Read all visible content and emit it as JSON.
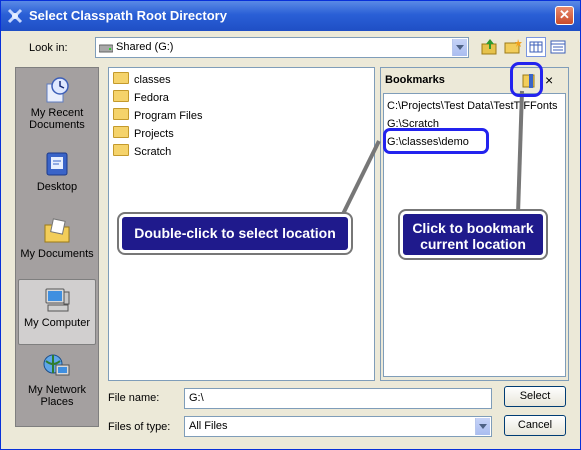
{
  "window": {
    "title": "Select Classpath Root Directory",
    "close_glyph": "✕"
  },
  "lookin": {
    "label": "Look in:",
    "value": "Shared (G:)"
  },
  "places": [
    {
      "label": "My Recent Documents",
      "icon": "recent-documents-icon"
    },
    {
      "label": "Desktop",
      "icon": "desktop-icon"
    },
    {
      "label": "My Documents",
      "icon": "my-documents-icon"
    },
    {
      "label": "My Computer",
      "icon": "my-computer-icon"
    },
    {
      "label": "My Network Places",
      "icon": "network-places-icon"
    }
  ],
  "folders": [
    "classes",
    "Fedora",
    "Program Files",
    "Projects",
    "Scratch"
  ],
  "bookmarks": {
    "title": "Bookmarks",
    "close_glyph": "×",
    "items": [
      "C:\\Projects\\Test Data\\TestTIFFonts",
      "G:\\Scratch",
      "G:\\classes\\demo"
    ]
  },
  "filename": {
    "label": "File name:",
    "value": "G:\\"
  },
  "filetype": {
    "label": "Files of type:",
    "value": "All Files"
  },
  "buttons": {
    "select": "Select",
    "cancel": "Cancel"
  },
  "callouts": {
    "select_location": "Double-click to select location",
    "bookmark_location": "Click to bookmark current location"
  },
  "colors": {
    "titlebar": "#2a5fd6",
    "callout": "#1f1a8c",
    "highlight": "#2323ee"
  }
}
